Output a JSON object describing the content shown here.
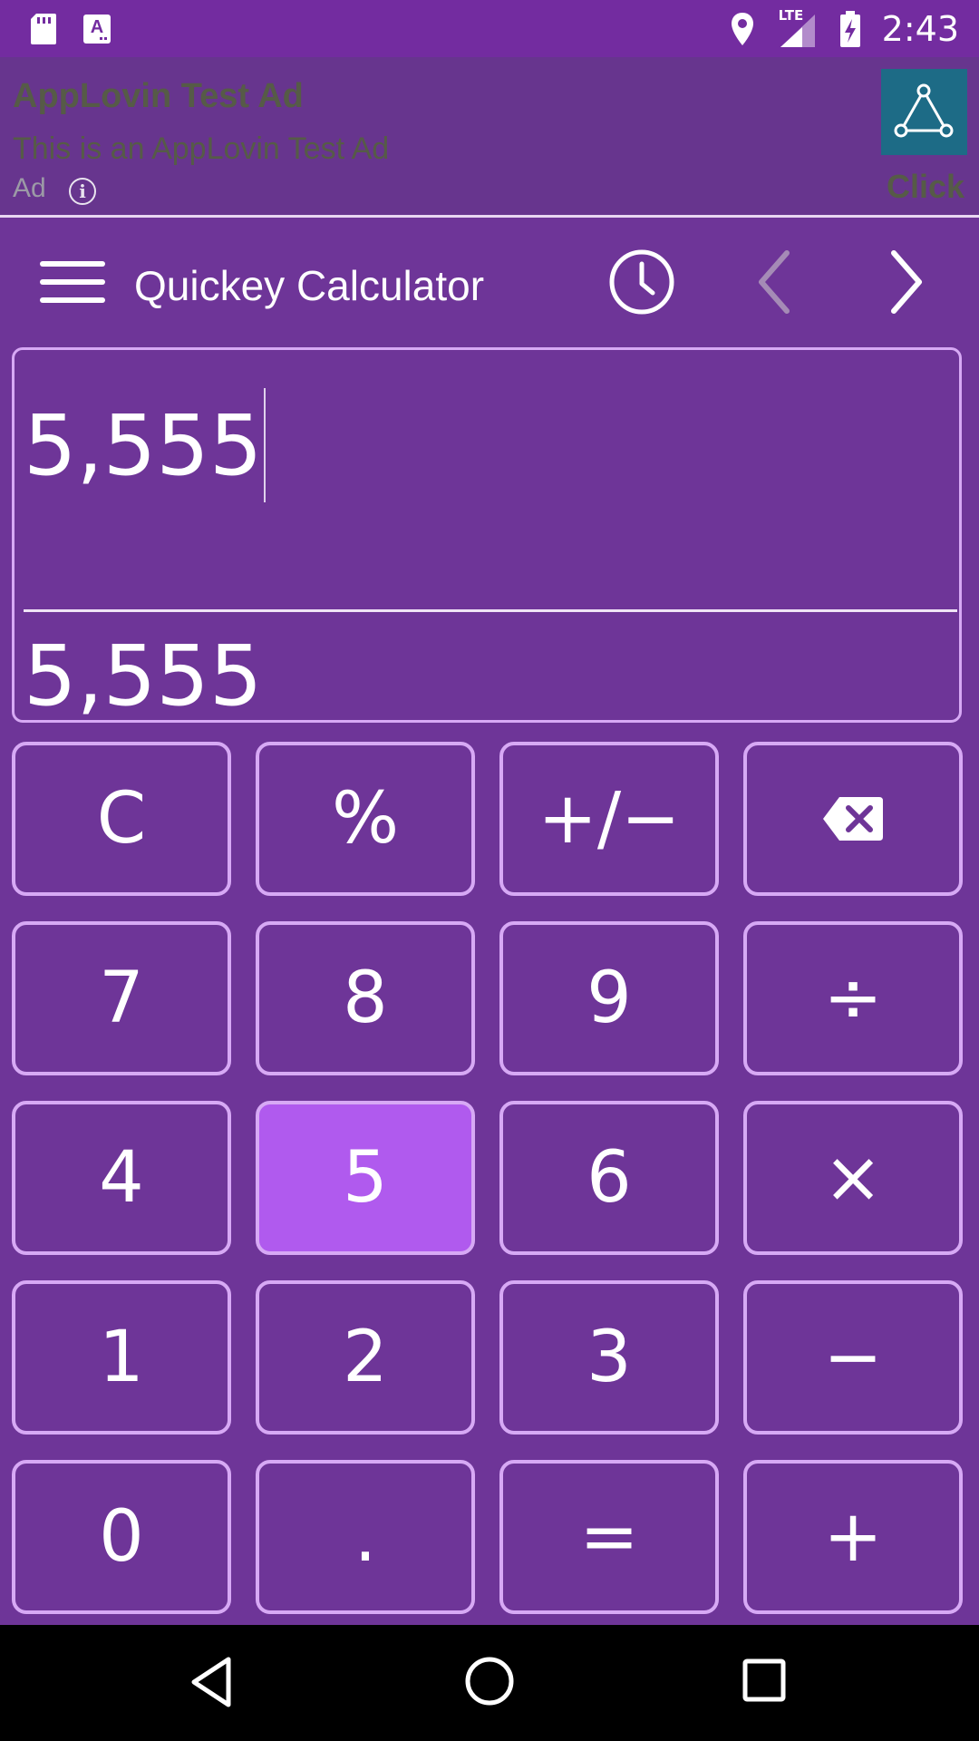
{
  "status_bar": {
    "time": "2:43",
    "network": "LTE",
    "icons": [
      "sd-card-icon",
      "font-notification-icon",
      "location-icon",
      "lte-signal-icon",
      "battery-charging-icon"
    ]
  },
  "ad": {
    "title": "AppLovin Test Ad",
    "description": "This is an AppLovin Test Ad",
    "label": "Ad",
    "info": "i",
    "cta": "Click"
  },
  "toolbar": {
    "title": "Quickey Calculator"
  },
  "display": {
    "expression": "5,555",
    "result": "5,555"
  },
  "keypad": {
    "rows": [
      [
        "C",
        "%",
        "+/−",
        "⌫"
      ],
      [
        "7",
        "8",
        "9",
        "÷"
      ],
      [
        "4",
        "5",
        "6",
        "×"
      ],
      [
        "1",
        "2",
        "3",
        "−"
      ],
      [
        "0",
        ".",
        "=",
        "+"
      ]
    ],
    "pressed": "5"
  },
  "colors": {
    "background": "#6e3598",
    "status_bar": "#732ca0",
    "ad_background": "#67358e",
    "key_border": "#d7a9f5",
    "key_pressed": "#b05aee",
    "nav_bar": "#000000"
  }
}
